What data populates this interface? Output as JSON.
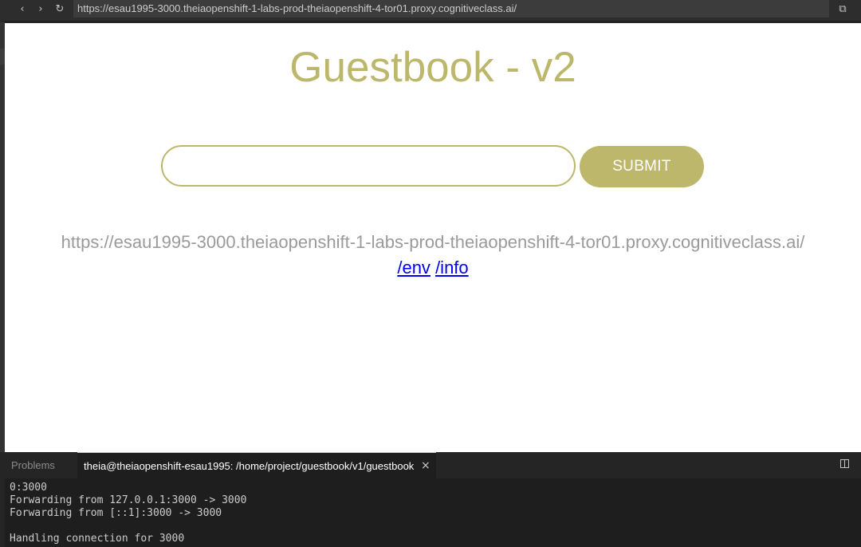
{
  "browser": {
    "url": "https://esau1995-3000.theiaopenshift-1-labs-prod-theiaopenshift-4-tor01.proxy.cognitiveclass.ai/",
    "back_icon": "‹",
    "forward_icon": "›",
    "reload_icon": "↻",
    "open_external_icon": "⧉"
  },
  "page": {
    "title": "Guestbook - v2",
    "input_value": "",
    "submit_label": "SUBMIT",
    "host_url": "https://esau1995-3000.theiaopenshift-1-labs-prod-theiaopenshift-4-tor01.proxy.cognitiveclass.ai/",
    "link_env": "/env",
    "link_info": "/info"
  },
  "panel": {
    "tabs": [
      "Problems",
      "theia@theiaopenshift-esau1995: /home/project/guestbook/v1/guestbook"
    ],
    "close_icon": "×",
    "terminal_lines": [
      "0:3000",
      "Forwarding from 127.0.0.1:3000 -> 3000",
      "Forwarding from [::1]:3000 -> 3000",
      "",
      "Handling connection for 3000"
    ]
  },
  "colors": {
    "accent": "#bdb76b",
    "link": "#0000ee",
    "host_text": "#9a9a9a",
    "terminal_bg": "#1e1e1e"
  }
}
